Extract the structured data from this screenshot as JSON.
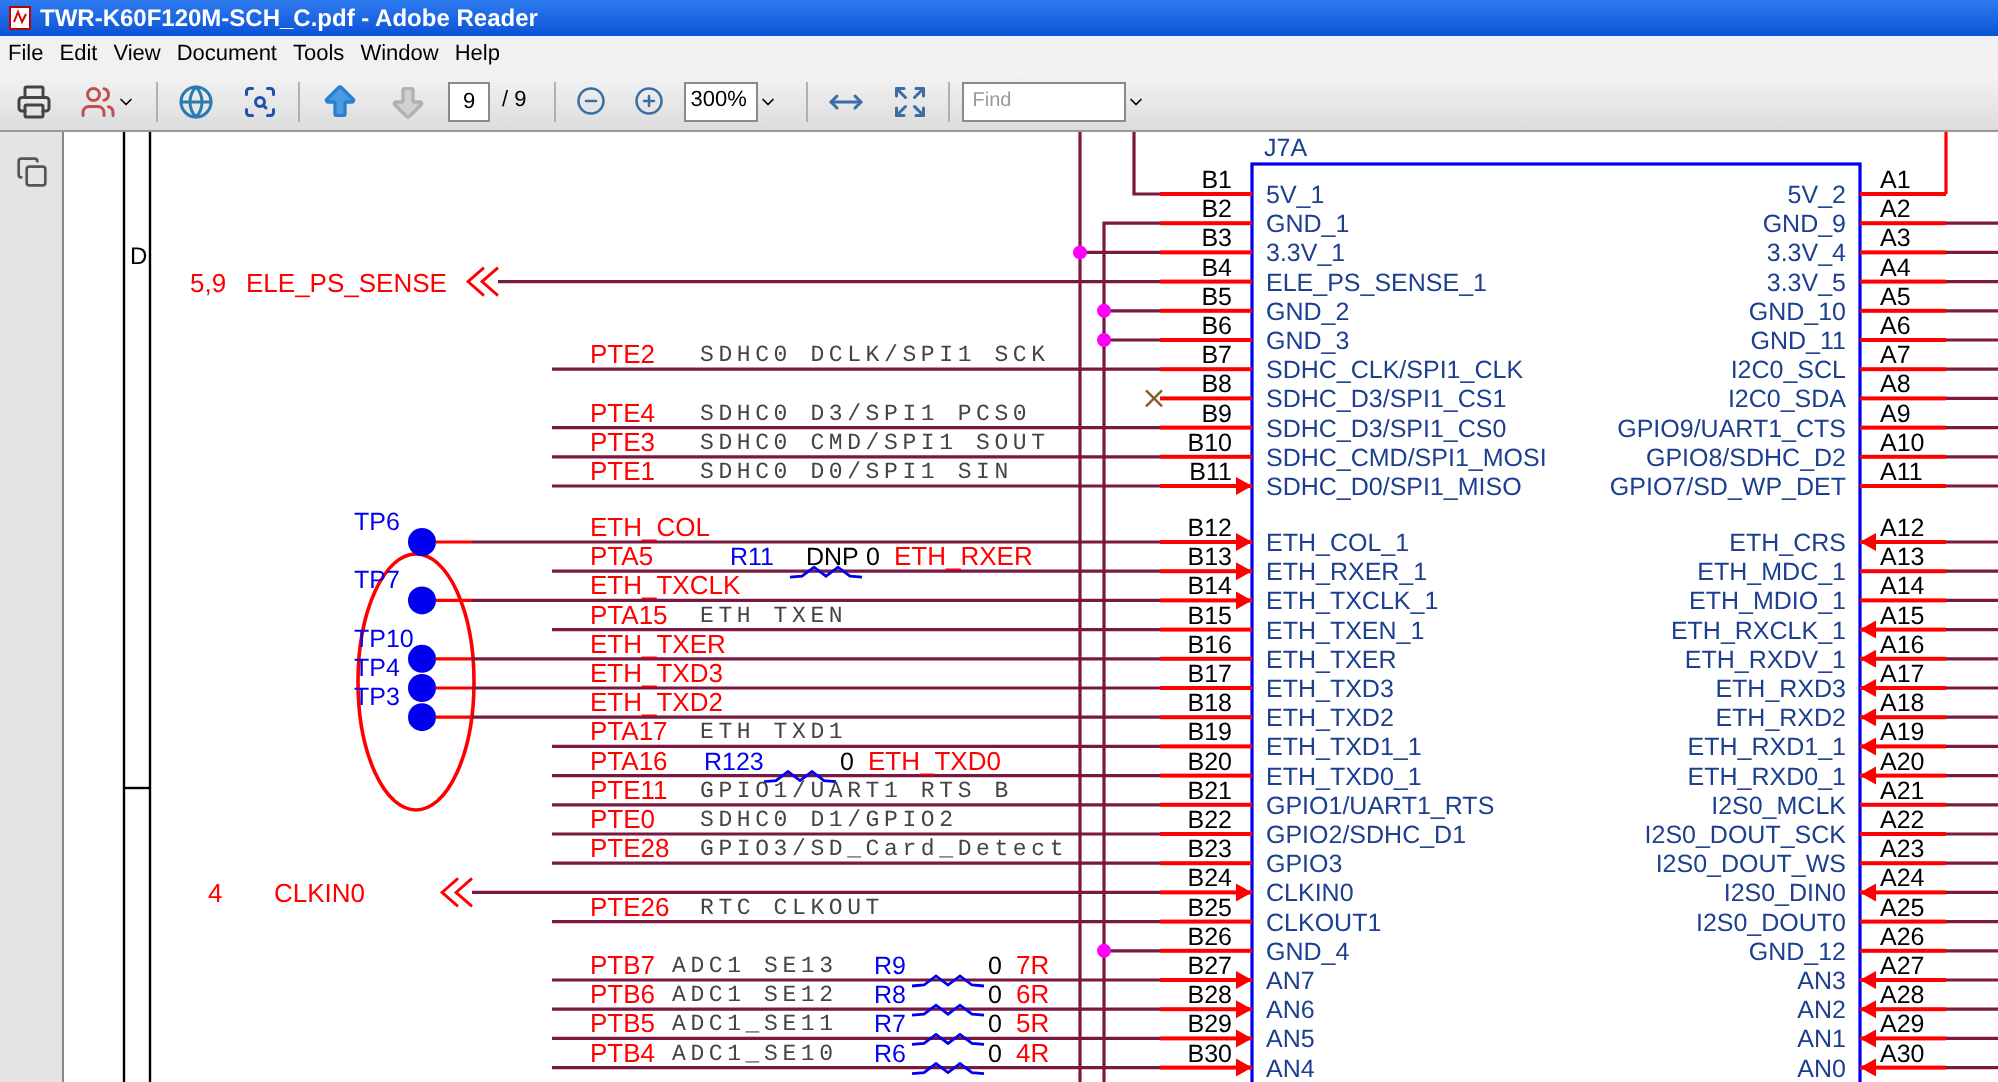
{
  "window": {
    "title": "TWR-K60F120M-SCH_C.pdf - Adobe Reader"
  },
  "menu": [
    "File",
    "Edit",
    "View",
    "Document",
    "Tools",
    "Window",
    "Help"
  ],
  "toolbar": {
    "page": "9",
    "page_count": "/ 9",
    "zoom": "300%",
    "find_placeholder": "Find",
    "prev_disabled": false,
    "next_disabled": true
  },
  "schematic": {
    "zone": "D",
    "part": "J7A",
    "groups": [
      [
        {
          "b_pin": "B1",
          "b_name": "5V_1",
          "b_in": false,
          "a_pin": "A1",
          "a_name": "5V_2",
          "a_in": false,
          "net": {
            "kind": "up"
          }
        },
        {
          "b_pin": "B2",
          "b_name": "GND_1",
          "b_in": false,
          "a_pin": "A2",
          "a_name": "GND_9",
          "a_in": false,
          "net": {
            "kind": "bus_start"
          }
        },
        {
          "b_pin": "B3",
          "b_name": "3.3V_1",
          "b_in": false,
          "a_pin": "A3",
          "a_name": "3.3V_4",
          "a_in": false,
          "net": {
            "kind": "junction_outer"
          }
        },
        {
          "b_pin": "B4",
          "b_name": "ELE_PS_SENSE_1",
          "b_in": false,
          "a_pin": "A4",
          "a_name": "3.3V_5",
          "a_in": false,
          "net": {
            "kind": "offpage",
            "ref": "5,9",
            "name": "ELE_PS_SENSE"
          }
        },
        {
          "b_pin": "B5",
          "b_name": "GND_2",
          "b_in": false,
          "a_pin": "A5",
          "a_name": "GND_10",
          "a_in": false,
          "net": {
            "kind": "junction_inner"
          }
        },
        {
          "b_pin": "B6",
          "b_name": "GND_3",
          "b_in": false,
          "a_pin": "A6",
          "a_name": "GND_11",
          "a_in": false,
          "net": {
            "kind": "junction_inner"
          }
        },
        {
          "b_pin": "B7",
          "b_name": "SDHC_CLK/SPI1_CLK",
          "b_in": false,
          "a_pin": "A7",
          "a_name": "I2C0_SCL",
          "a_in": false,
          "net": {
            "kind": "port",
            "port": "PTE2",
            "signal": "SDHC0 DCLK/SPI1 SCK"
          }
        },
        {
          "b_pin": "B8",
          "b_name": "SDHC_D3/SPI1_CS1",
          "b_in": false,
          "a_pin": "A8",
          "a_name": "I2C0_SDA",
          "a_in": false,
          "net": {
            "kind": "nc"
          }
        },
        {
          "b_pin": "B9",
          "b_name": "SDHC_D3/SPI1_CS0",
          "b_in": false,
          "a_pin": "A9",
          "a_name": "GPIO9/UART1_CTS",
          "a_in": false,
          "net": {
            "kind": "port",
            "port": "PTE4",
            "signal": "SDHC0 D3/SPI1 PCS0"
          }
        },
        {
          "b_pin": "B10",
          "b_name": "SDHC_CMD/SPI1_MOSI",
          "b_in": false,
          "a_pin": "A10",
          "a_name": "GPIO8/SDHC_D2",
          "a_in": false,
          "net": {
            "kind": "port",
            "port": "PTE3",
            "signal": "SDHC0 CMD/SPI1 SOUT"
          }
        },
        {
          "b_pin": "B11",
          "b_name": "SDHC_D0/SPI1_MISO",
          "b_in": true,
          "a_pin": "A11",
          "a_name": "GPIO7/SD_WP_DET",
          "a_in": false,
          "net": {
            "kind": "port",
            "port": "PTE1",
            "signal": "SDHC0 D0/SPI1 SIN"
          }
        }
      ],
      [
        {
          "b_pin": "B12",
          "b_name": "ETH_COL_1",
          "b_in": true,
          "a_pin": "A12",
          "a_name": "ETH_CRS",
          "a_in": true,
          "net": {
            "kind": "port",
            "port": "ETH_COL",
            "tp": "TP6"
          }
        },
        {
          "b_pin": "B13",
          "b_name": "ETH_RXER_1",
          "b_in": true,
          "a_pin": "A13",
          "a_name": "ETH_MDC_1",
          "a_in": false,
          "net": {
            "kind": "port",
            "port": "PTA5",
            "res": {
              "ref": "R11",
              "note": "DNP",
              "value": "0",
              "net": "ETH_RXER"
            }
          }
        },
        {
          "b_pin": "B14",
          "b_name": "ETH_TXCLK_1",
          "b_in": true,
          "a_pin": "A14",
          "a_name": "ETH_MDIO_1",
          "a_in": false,
          "net": {
            "kind": "port",
            "port": "ETH_TXCLK",
            "tp": "TP7"
          }
        },
        {
          "b_pin": "B15",
          "b_name": "ETH_TXEN_1",
          "b_in": false,
          "a_pin": "A15",
          "a_name": "ETH_RXCLK_1",
          "a_in": true,
          "net": {
            "kind": "port",
            "port": "PTA15",
            "signal": "ETH TXEN"
          }
        },
        {
          "b_pin": "B16",
          "b_name": "ETH_TXER",
          "b_in": false,
          "a_pin": "A16",
          "a_name": "ETH_RXDV_1",
          "a_in": true,
          "net": {
            "kind": "port",
            "port": "ETH_TXER",
            "tp": "TP10"
          }
        },
        {
          "b_pin": "B17",
          "b_name": "ETH_TXD3",
          "b_in": false,
          "a_pin": "A17",
          "a_name": "ETH_RXD3",
          "a_in": true,
          "net": {
            "kind": "port",
            "port": "ETH_TXD3",
            "tp": "TP4"
          }
        },
        {
          "b_pin": "B18",
          "b_name": "ETH_TXD2",
          "b_in": false,
          "a_pin": "A18",
          "a_name": "ETH_RXD2",
          "a_in": true,
          "net": {
            "kind": "port",
            "port": "ETH_TXD2",
            "tp": "TP3"
          }
        },
        {
          "b_pin": "B19",
          "b_name": "ETH_TXD1_1",
          "b_in": false,
          "a_pin": "A19",
          "a_name": "ETH_RXD1_1",
          "a_in": true,
          "net": {
            "kind": "port",
            "port": "PTA17",
            "signal": "ETH TXD1"
          }
        },
        {
          "b_pin": "B20",
          "b_name": "ETH_TXD0_1",
          "b_in": false,
          "a_pin": "A20",
          "a_name": "ETH_RXD0_1",
          "a_in": true,
          "net": {
            "kind": "port",
            "port": "PTA16",
            "res": {
              "ref": "R123",
              "value": "0",
              "net": "ETH_TXD0"
            }
          }
        },
        {
          "b_pin": "B21",
          "b_name": "GPIO1/UART1_RTS",
          "b_in": false,
          "a_pin": "A21",
          "a_name": "I2S0_MCLK",
          "a_in": false,
          "net": {
            "kind": "port",
            "port": "PTE11",
            "signal": "GPIO1/UART1 RTS B"
          }
        },
        {
          "b_pin": "B22",
          "b_name": "GPIO2/SDHC_D1",
          "b_in": false,
          "a_pin": "A22",
          "a_name": "I2S0_DOUT_SCK",
          "a_in": false,
          "net": {
            "kind": "port",
            "port": "PTE0",
            "signal": "SDHC0 D1/GPIO2"
          }
        },
        {
          "b_pin": "B23",
          "b_name": "GPIO3",
          "b_in": false,
          "a_pin": "A23",
          "a_name": "I2S0_DOUT_WS",
          "a_in": false,
          "net": {
            "kind": "port",
            "port": "PTE28",
            "signal": "GPIO3/SD_Card_Detect"
          }
        },
        {
          "b_pin": "B24",
          "b_name": "CLKIN0",
          "b_in": true,
          "a_pin": "A24",
          "a_name": "I2S0_DIN0",
          "a_in": true,
          "net": {
            "kind": "offpage",
            "ref": "4",
            "name": "CLKIN0"
          }
        },
        {
          "b_pin": "B25",
          "b_name": "CLKOUT1",
          "b_in": false,
          "a_pin": "A25",
          "a_name": "I2S0_DOUT0",
          "a_in": false,
          "net": {
            "kind": "port",
            "port": "PTE26",
            "signal": "RTC CLKOUT"
          }
        },
        {
          "b_pin": "B26",
          "b_name": "GND_4",
          "b_in": false,
          "a_pin": "A26",
          "a_name": "GND_12",
          "a_in": false,
          "net": {
            "kind": "junction_inner"
          }
        },
        {
          "b_pin": "B27",
          "b_name": "AN7",
          "b_in": true,
          "a_pin": "A27",
          "a_name": "AN3",
          "a_in": true,
          "net": {
            "kind": "port",
            "port": "PTB7",
            "signal": "ADC1 SE13",
            "res": {
              "ref": "R9",
              "value": "0",
              "net": "7R"
            }
          }
        },
        {
          "b_pin": "B28",
          "b_name": "AN6",
          "b_in": true,
          "a_pin": "A28",
          "a_name": "AN2",
          "a_in": true,
          "net": {
            "kind": "port",
            "port": "PTB6",
            "signal": "ADC1 SE12",
            "res": {
              "ref": "R8",
              "value": "0",
              "net": "6R"
            }
          }
        },
        {
          "b_pin": "B29",
          "b_name": "AN5",
          "b_in": true,
          "a_pin": "A29",
          "a_name": "AN1",
          "a_in": true,
          "net": {
            "kind": "port",
            "port": "PTB5",
            "signal": "ADC1_SE11",
            "res": {
              "ref": "R7",
              "value": "0",
              "net": "5R"
            }
          }
        },
        {
          "b_pin": "B30",
          "b_name": "AN4",
          "b_in": true,
          "a_pin": "A30",
          "a_name": "AN0",
          "a_in": true,
          "net": {
            "kind": "port",
            "port": "PTB4",
            "signal": "ADC1_SE10",
            "res": {
              "ref": "R6",
              "value": "0",
              "net": "4R"
            }
          }
        }
      ]
    ]
  }
}
